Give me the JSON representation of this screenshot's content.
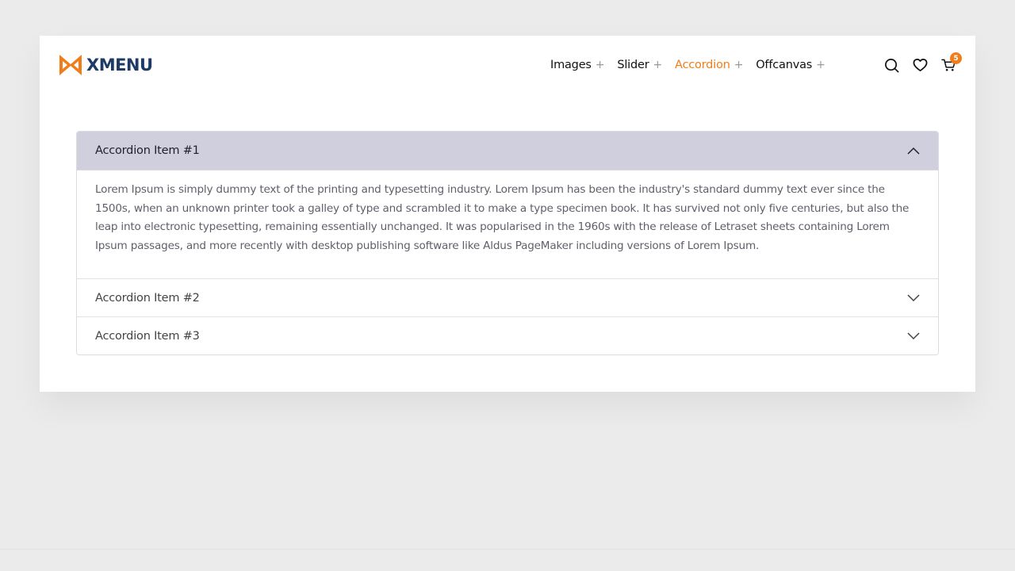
{
  "brand": {
    "name": "XMENU",
    "accent_color": "#f07d1a",
    "text_color": "#1e3a66"
  },
  "nav": {
    "items": [
      {
        "label": "Images",
        "plus": "+"
      },
      {
        "label": "Slider",
        "plus": "+"
      },
      {
        "label": "Accordion",
        "plus": "+"
      },
      {
        "label": "Offcanvas",
        "plus": "+"
      }
    ],
    "active": "Accordion"
  },
  "header_icons": {
    "search": "search-icon",
    "wishlist": "heart-icon",
    "cart": "cart-icon",
    "cart_count": "5"
  },
  "accordion": {
    "items": [
      {
        "title": "Accordion Item #1",
        "open": true,
        "body": "Lorem Ipsum is simply dummy text of the printing and typesetting industry. Lorem Ipsum has been the industry's standard dummy text ever since the 1500s, when an unknown printer took a galley of type and scrambled it to make a type specimen book. It has survived not only five centuries, but also the leap into electronic typesetting, remaining essentially unchanged. It was popularised in the 1960s with the release of Letraset sheets containing Lorem Ipsum passages, and more recently with desktop publishing software like Aldus PageMaker including versions of Lorem Ipsum."
      },
      {
        "title": "Accordion Item #2",
        "open": false
      },
      {
        "title": "Accordion Item #3",
        "open": false
      }
    ],
    "open_header_color": "#cfcfdd"
  }
}
